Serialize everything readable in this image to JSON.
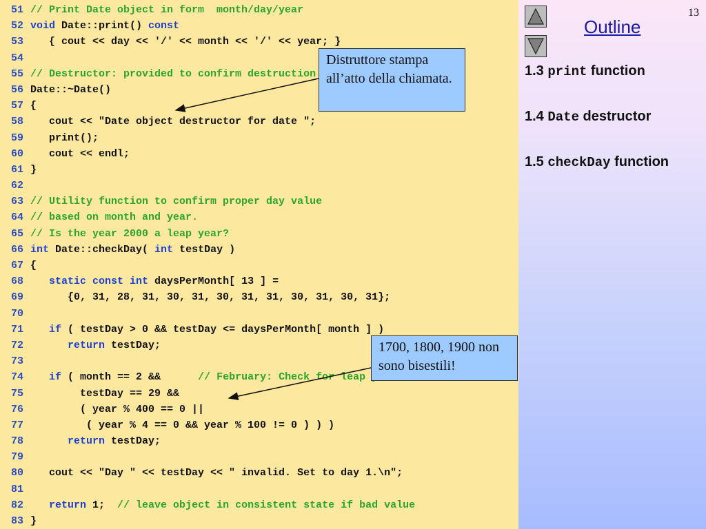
{
  "code": {
    "lines": [
      {
        "no": "51",
        "segments": [
          {
            "t": "// Print Date object in form  month/day/year",
            "c": "comment"
          }
        ]
      },
      {
        "no": "52",
        "segments": [
          {
            "t": "void",
            "c": "keyword"
          },
          {
            "t": " Date::print() ",
            "c": "text"
          },
          {
            "t": "const",
            "c": "keyword"
          }
        ]
      },
      {
        "no": "53",
        "segments": [
          {
            "t": "   { cout << day << '/' << month << '/' << year; }",
            "c": "text"
          }
        ]
      },
      {
        "no": "54",
        "segments": []
      },
      {
        "no": "55",
        "segments": [
          {
            "t": "// Destructor: provided to confirm destruction order",
            "c": "comment"
          }
        ]
      },
      {
        "no": "56",
        "segments": [
          {
            "t": "Date::~Date()",
            "c": "text"
          }
        ]
      },
      {
        "no": "57",
        "segments": [
          {
            "t": "{",
            "c": "text"
          }
        ]
      },
      {
        "no": "58",
        "segments": [
          {
            "t": "   cout << \"Date object destructor for date \";",
            "c": "text"
          }
        ]
      },
      {
        "no": "59",
        "segments": [
          {
            "t": "   print();",
            "c": "text"
          }
        ]
      },
      {
        "no": "60",
        "segments": [
          {
            "t": "   cout << endl;",
            "c": "text"
          }
        ]
      },
      {
        "no": "61",
        "segments": [
          {
            "t": "}",
            "c": "text"
          }
        ]
      },
      {
        "no": "62",
        "segments": []
      },
      {
        "no": "63",
        "segments": [
          {
            "t": "// Utility function to confirm proper day value",
            "c": "comment"
          }
        ]
      },
      {
        "no": "64",
        "segments": [
          {
            "t": "// based on month and year.",
            "c": "comment"
          }
        ]
      },
      {
        "no": "65",
        "segments": [
          {
            "t": "// Is the year 2000 a leap year?",
            "c": "comment"
          }
        ]
      },
      {
        "no": "66",
        "segments": [
          {
            "t": "int",
            "c": "keyword"
          },
          {
            "t": " Date::checkDay( ",
            "c": "text"
          },
          {
            "t": "int",
            "c": "keyword"
          },
          {
            "t": " testDay )",
            "c": "text"
          }
        ]
      },
      {
        "no": "67",
        "segments": [
          {
            "t": "{",
            "c": "text"
          }
        ]
      },
      {
        "no": "68",
        "segments": [
          {
            "t": "   ",
            "c": "text"
          },
          {
            "t": "static const int",
            "c": "keyword"
          },
          {
            "t": " daysPerMonth[ 13 ] =",
            "c": "text"
          }
        ]
      },
      {
        "no": "69",
        "segments": [
          {
            "t": "      {0, 31, 28, 31, 30, 31, 30, 31, 31, 30, 31, 30, 31};",
            "c": "text"
          }
        ]
      },
      {
        "no": "70",
        "segments": []
      },
      {
        "no": "71",
        "segments": [
          {
            "t": "   ",
            "c": "text"
          },
          {
            "t": "if",
            "c": "keyword"
          },
          {
            "t": " ( testDay > 0 && testDay <= daysPerMonth[ month ] )",
            "c": "text"
          }
        ]
      },
      {
        "no": "72",
        "segments": [
          {
            "t": "      ",
            "c": "text"
          },
          {
            "t": "return",
            "c": "keyword"
          },
          {
            "t": " testDay;",
            "c": "text"
          }
        ]
      },
      {
        "no": "73",
        "segments": []
      },
      {
        "no": "74",
        "segments": [
          {
            "t": "   ",
            "c": "text"
          },
          {
            "t": "if",
            "c": "keyword"
          },
          {
            "t": " ( month == 2 &&      ",
            "c": "text"
          },
          {
            "t": "// February: Check for leap year",
            "c": "comment"
          }
        ]
      },
      {
        "no": "75",
        "segments": [
          {
            "t": "        testDay == 29 &&",
            "c": "text"
          }
        ]
      },
      {
        "no": "76",
        "segments": [
          {
            "t": "        ( year % 400 == 0 ||",
            "c": "text"
          }
        ]
      },
      {
        "no": "77",
        "segments": [
          {
            "t": "         ( year % 4 == 0 && year % 100 != 0 ) ) )",
            "c": "text"
          }
        ]
      },
      {
        "no": "78",
        "segments": [
          {
            "t": "      ",
            "c": "text"
          },
          {
            "t": "return",
            "c": "keyword"
          },
          {
            "t": " testDay;",
            "c": "text"
          }
        ]
      },
      {
        "no": "79",
        "segments": []
      },
      {
        "no": "80",
        "segments": [
          {
            "t": "   cout << \"Day \" << testDay << \" invalid. Set to day 1.\\n\";",
            "c": "text"
          }
        ]
      },
      {
        "no": "81",
        "segments": []
      },
      {
        "no": "82",
        "segments": [
          {
            "t": "   ",
            "c": "text"
          },
          {
            "t": "return",
            "c": "keyword"
          },
          {
            "t": " 1;  ",
            "c": "text"
          },
          {
            "t": "// leave object in consistent state if bad value",
            "c": "comment"
          }
        ]
      },
      {
        "no": "83",
        "segments": [
          {
            "t": "}",
            "c": "text"
          }
        ]
      }
    ]
  },
  "callouts": {
    "destructor": "Distruttore stampa all’atto della chiamata.",
    "leap": "1700, 1800, 1900 non sono bisestili!"
  },
  "sidebar": {
    "slide_number": "13",
    "title": "Outline",
    "items": [
      {
        "num": "1.3 ",
        "code": "print",
        "label": " function"
      },
      {
        "num": "1.4 ",
        "code": "Date",
        "label": " destructor"
      },
      {
        "num": "1.5 ",
        "code": "checkDay",
        "label": " function"
      }
    ]
  },
  "icons": {
    "nav_up": "triangle-up-icon",
    "nav_down": "triangle-down-icon"
  },
  "colors": {
    "code_bg": "#fde8a0",
    "comment": "#2aa52a",
    "keyword": "#1f3fd0",
    "line_number": "#2a4cc4",
    "callout_bg": "#9dcbff",
    "outline_title": "#1a1aa6"
  }
}
